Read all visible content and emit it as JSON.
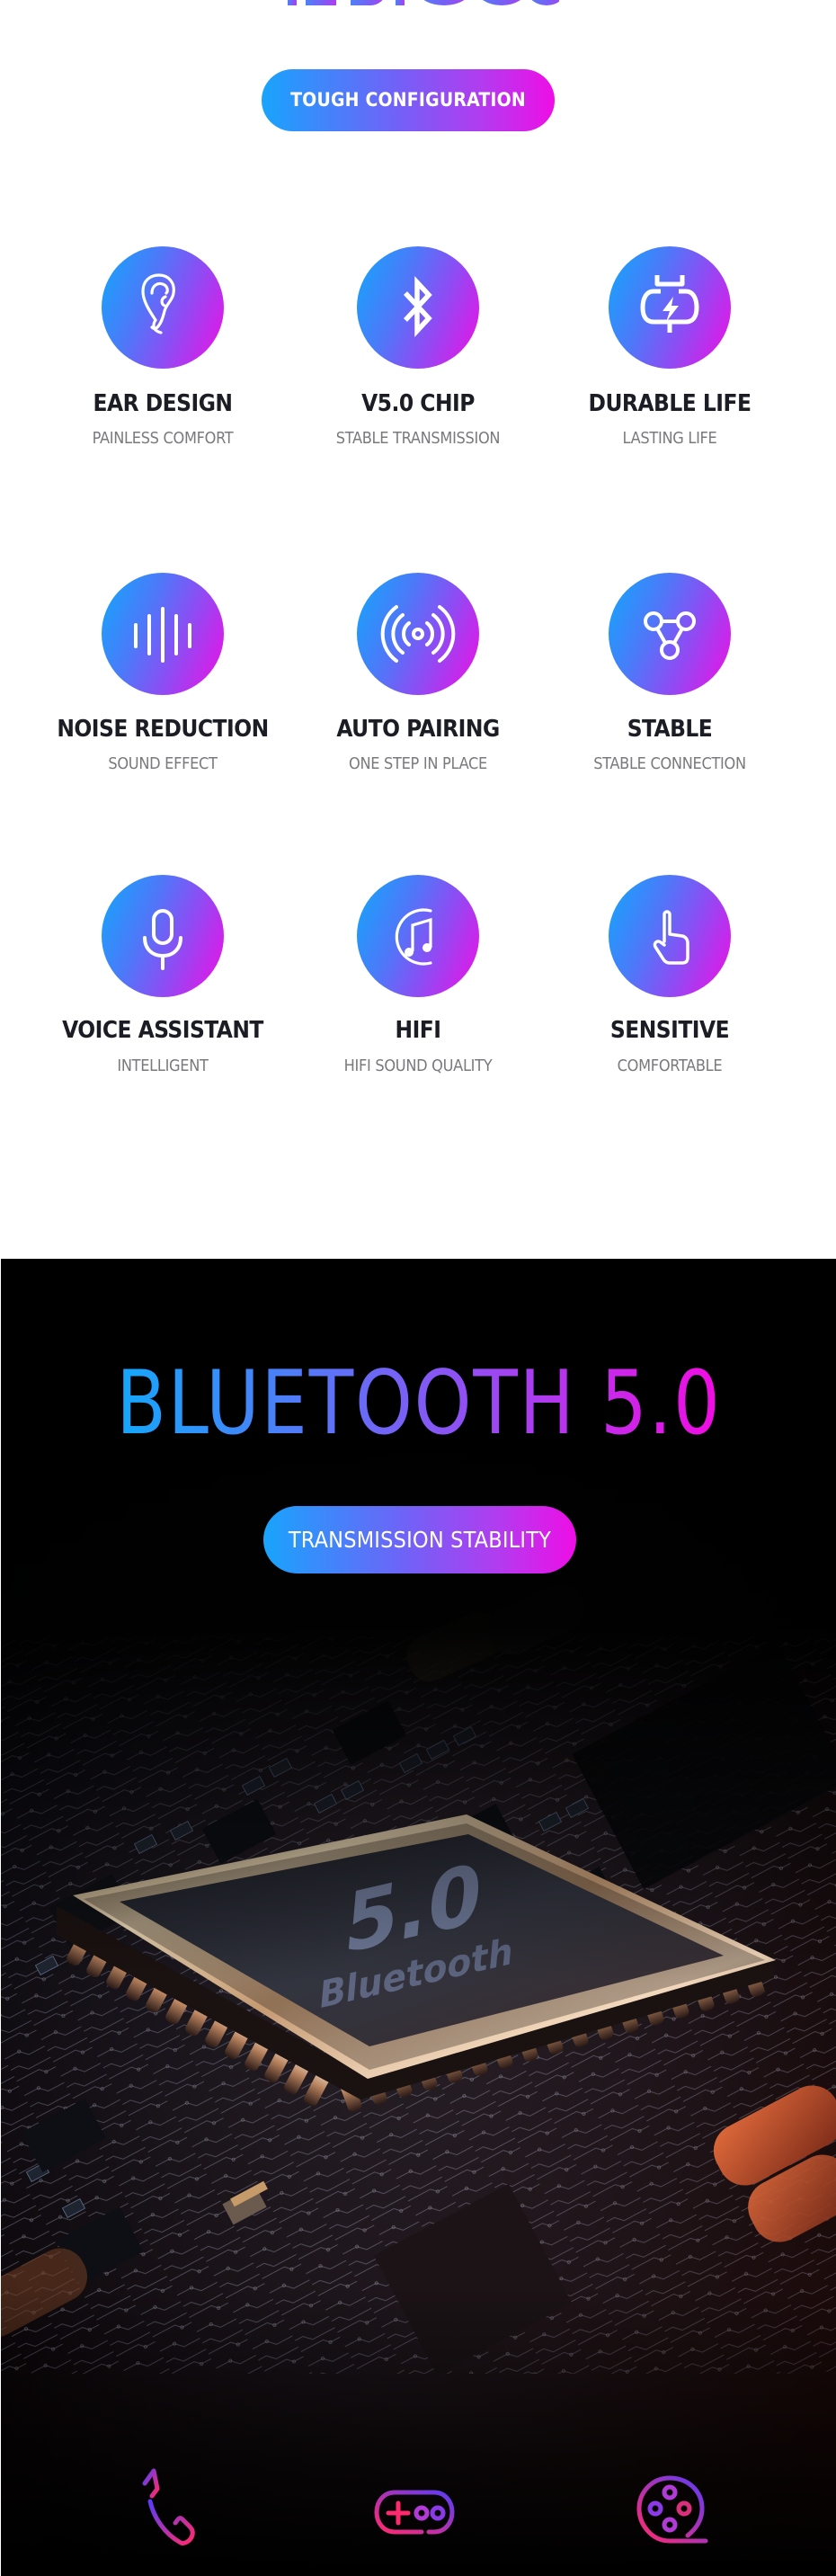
{
  "top_section": {
    "badge_label": "TOUGH CONFIGURATION",
    "features": [
      {
        "icon": "ear-icon",
        "title": "EAR DESIGN",
        "subtitle": "PAINLESS COMFORT"
      },
      {
        "icon": "bluetooth-icon",
        "title": "V5.0 CHIP",
        "subtitle": "STABLE TRANSMISSION"
      },
      {
        "icon": "charging-plug-icon",
        "title": "DURABLE LIFE",
        "subtitle": "LASTING LIFE"
      },
      {
        "icon": "sound-wave-icon",
        "title": "NOISE REDUCTION",
        "subtitle": "SOUND EFFECT"
      },
      {
        "icon": "broadcast-signal-icon",
        "title": "AUTO PAIRING",
        "subtitle": "ONE STEP IN PLACE"
      },
      {
        "icon": "connection-nodes-icon",
        "title": "STABLE",
        "subtitle": "STABLE CONNECTION"
      },
      {
        "icon": "microphone-icon",
        "title": "VOICE ASSISTANT",
        "subtitle": "INTELLIGENT"
      },
      {
        "icon": "music-note-icon",
        "title": "HIFI",
        "subtitle": "HIFI SOUND QUALITY"
      },
      {
        "icon": "touch-finger-icon",
        "title": "SENSITIVE",
        "subtitle": "COMFORTABLE"
      }
    ]
  },
  "bluetooth_section": {
    "heading": "BLUETOOTH 5.0",
    "badge_label": "TRANSMISSION STABILITY",
    "chip_label_version": "5.0",
    "chip_label_name": "Bluetooth",
    "usage_icons": [
      "phone-call-icon",
      "gamepad-icon",
      "film-reel-icon"
    ]
  },
  "colors": {
    "gradient_start": "#17a7fb",
    "gradient_mid": "#7f5cf5",
    "gradient_end": "#f20ae3",
    "title_text": "#1b1c24",
    "subtitle_text": "#7a7a7e",
    "dark_background": "#000000",
    "usage_icon_blue": "#5b3cf6",
    "usage_icon_pink": "#ff2a6d"
  }
}
